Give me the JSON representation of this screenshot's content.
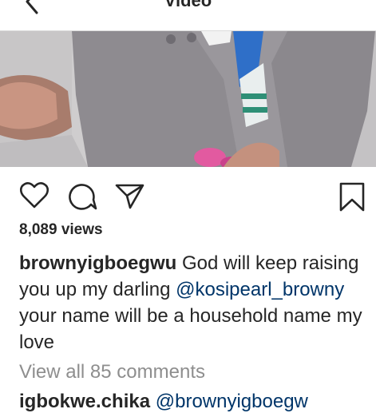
{
  "header": {
    "title": "Video",
    "back_icon": "chevron-left-icon"
  },
  "media": {
    "description_colors": {
      "coat": "#8f8c92",
      "background": "#c9c7c8",
      "accent": "#2f6fc8",
      "pink": "#e25aa0"
    }
  },
  "actions": {
    "icons": [
      "heart-icon",
      "comment-icon",
      "share-icon",
      "bookmark-icon"
    ]
  },
  "post": {
    "views": "8,089 views",
    "author": "brownyigboegwu",
    "caption_part1": "God will keep raising you up my darling",
    "mention": "@kosipearl_browny",
    "caption_part2": "your name will be a household name my love",
    "view_all_comments": "View all 85 comments"
  },
  "comment": {
    "user": "igbokwe.chika",
    "mention": "@brownyigboegw"
  },
  "colors": {
    "text": "#262626",
    "mention": "#003569",
    "muted": "#8e8e8e"
  }
}
